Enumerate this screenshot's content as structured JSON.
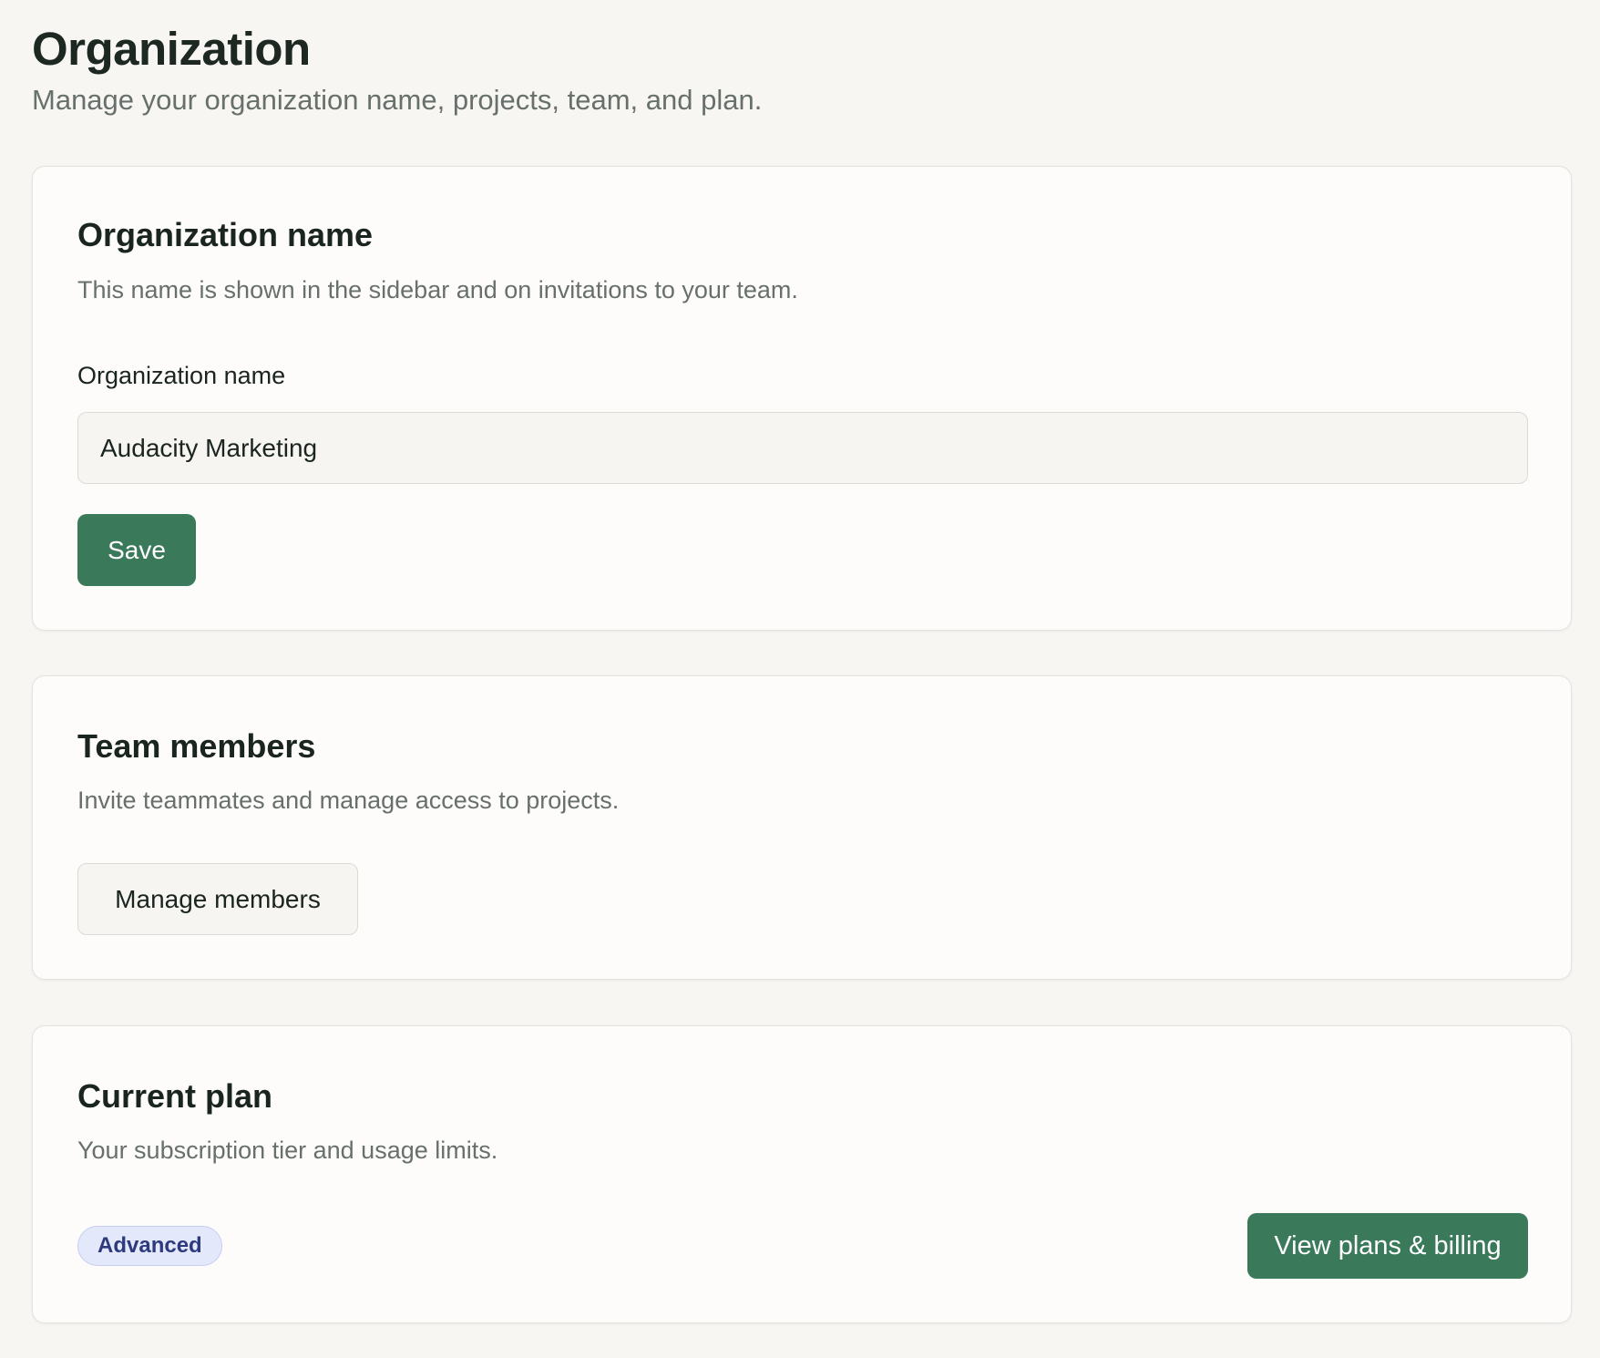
{
  "header": {
    "title": "Organization",
    "subtitle": "Manage your organization name, projects, team, and plan."
  },
  "org_name_card": {
    "title": "Organization name",
    "description": "This name is shown in the sidebar and on invitations to your team.",
    "field_label": "Organization name",
    "field_value": "Audacity Marketing",
    "save_label": "Save"
  },
  "team_card": {
    "title": "Team members",
    "description": "Invite teammates and manage access to projects.",
    "manage_label": "Manage members"
  },
  "plan_card": {
    "title": "Current plan",
    "description": "Your subscription tier and usage limits.",
    "plan_badge": "Advanced",
    "billing_label": "View plans & billing"
  },
  "colors": {
    "background": "#f7f6f3",
    "card": "#fdfcfa",
    "primary_button": "#3a7a5b",
    "badge_bg": "#e4e8fb",
    "badge_text": "#2e3a7e"
  }
}
